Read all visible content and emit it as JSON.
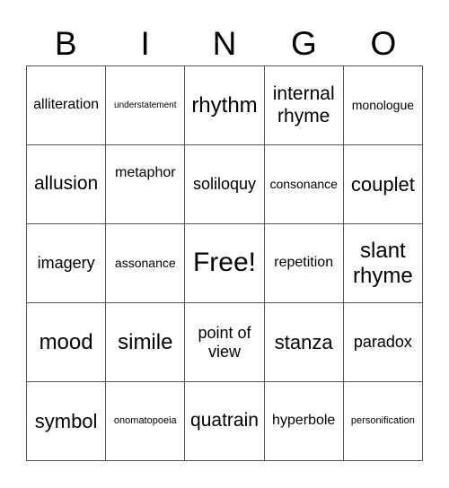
{
  "header": {
    "letters": [
      "B",
      "I",
      "N",
      "G",
      "O"
    ]
  },
  "cells": [
    [
      "alliteration",
      "understatement",
      "rhythm",
      "internal rhyme",
      "monologue"
    ],
    [
      "allusion",
      "metaphor",
      "soliloquy",
      "consonance",
      "couplet"
    ],
    [
      "imagery",
      "assonance",
      "Free!",
      "repetition",
      "slant rhyme"
    ],
    [
      "mood",
      "simile",
      "point of view",
      "stanza",
      "paradox"
    ],
    [
      "symbol",
      "onomatopoeia",
      "quatrain",
      "hyperbole",
      "personification"
    ]
  ],
  "colors": {
    "border": "#555555",
    "text": "#000000",
    "background": "#ffffff"
  }
}
